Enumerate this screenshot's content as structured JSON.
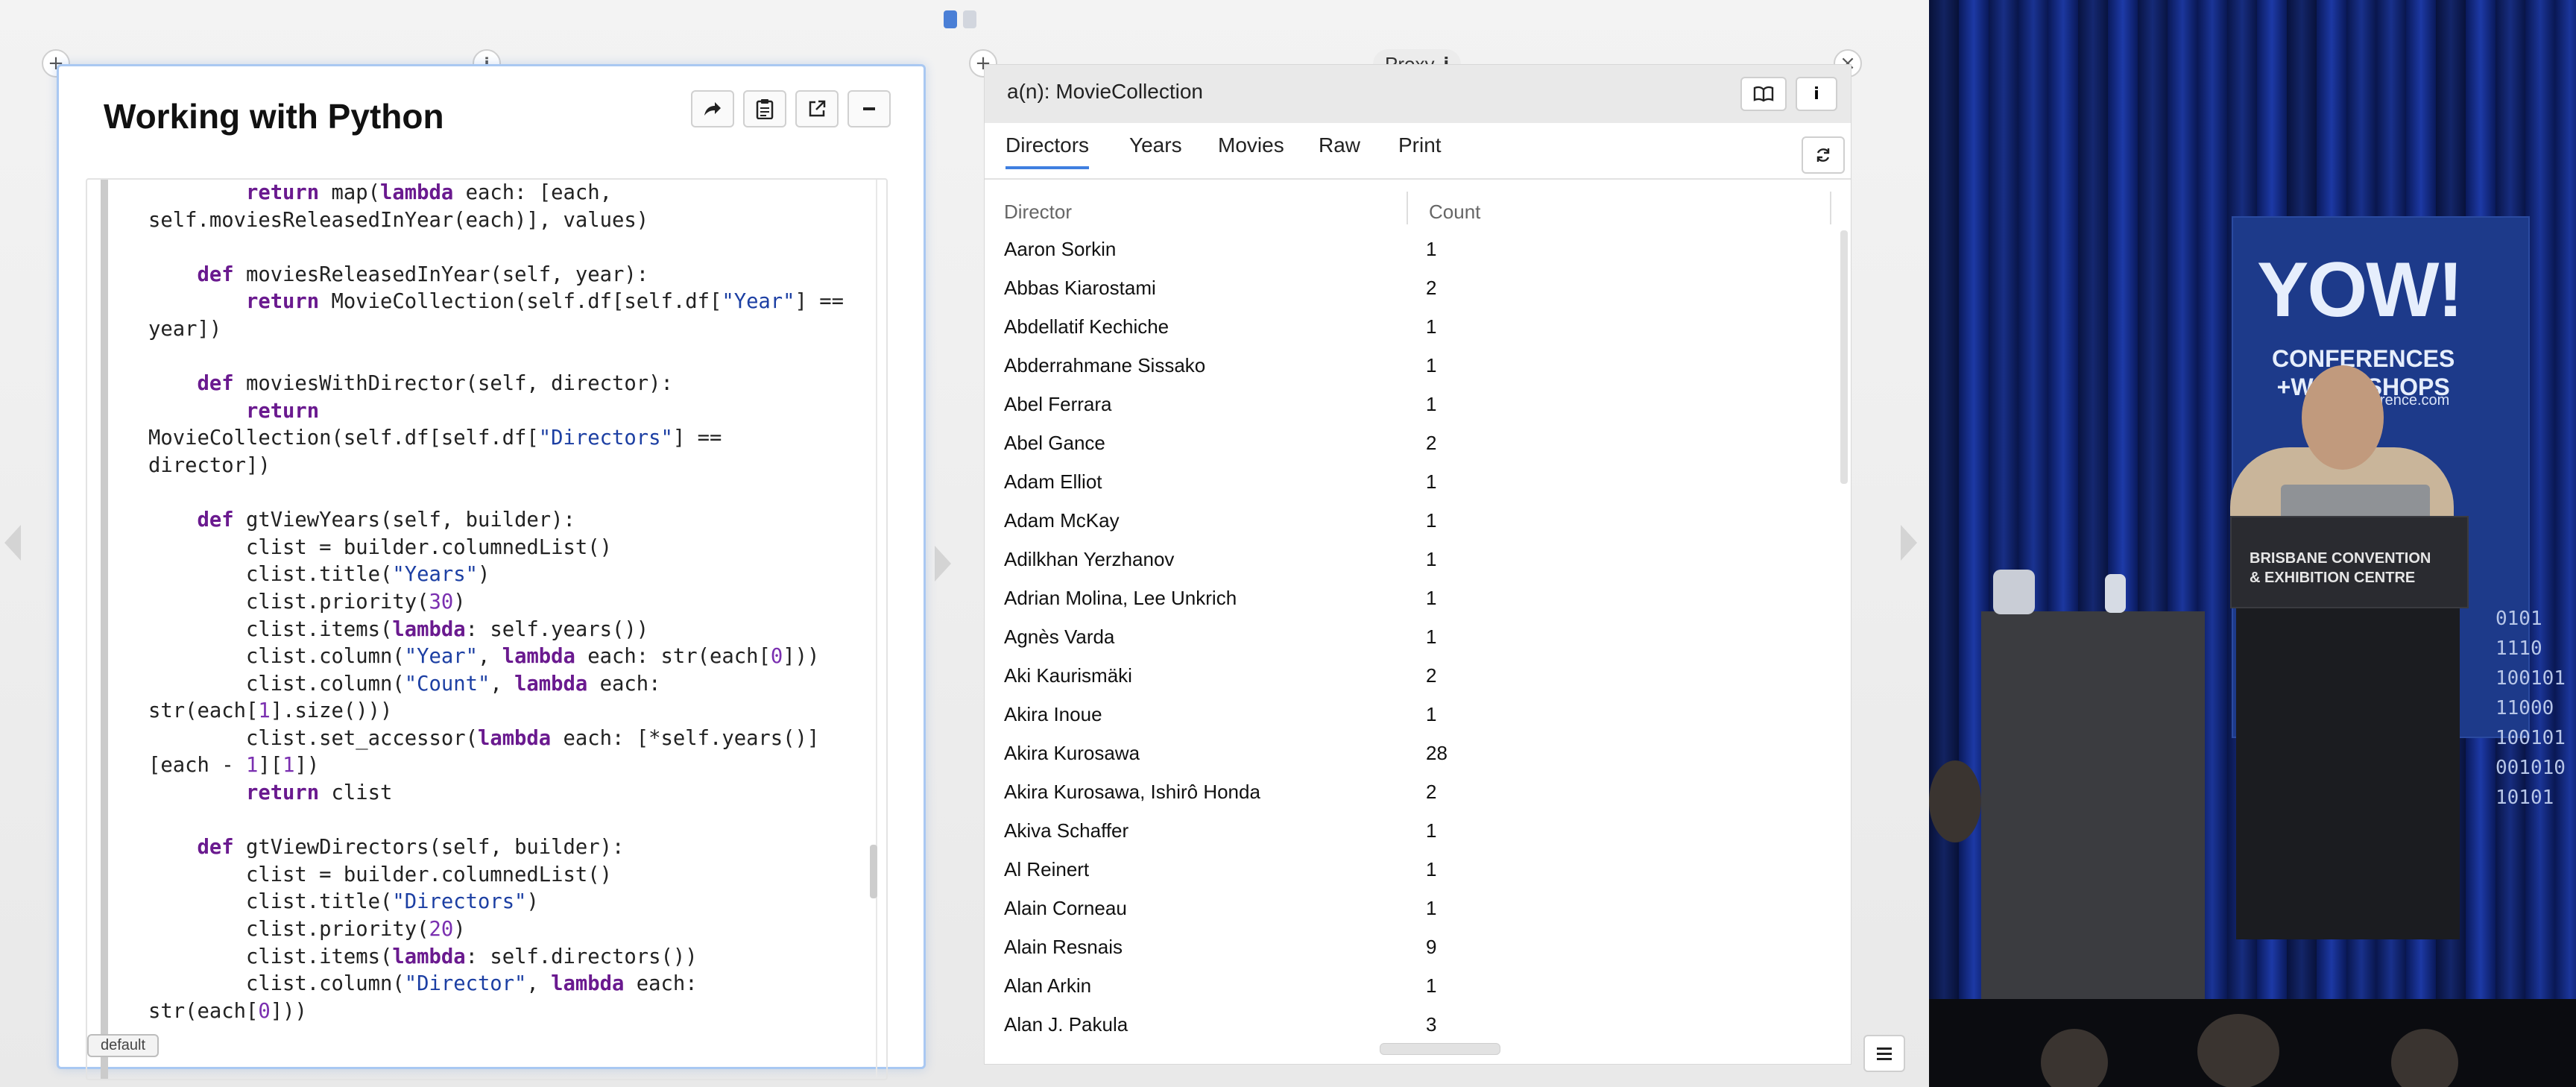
{
  "pager": {
    "count": 2,
    "active": 0
  },
  "code_pane": {
    "title": "Working with Python",
    "default_tag": "default",
    "code_lines": [
      [
        [
          "        ",
          ""
        ],
        [
          "return",
          "kw"
        ],
        [
          " map(",
          ""
        ],
        [
          "lambda",
          "kw"
        ],
        [
          " each: [each,",
          ""
        ]
      ],
      [
        [
          "self.moviesReleasedInYear(each)], values)",
          ""
        ]
      ],
      [
        [
          "",
          ""
        ]
      ],
      [
        [
          "    ",
          ""
        ],
        [
          "def",
          "kw"
        ],
        [
          " moviesReleasedInYear(self, year):",
          ""
        ]
      ],
      [
        [
          "        ",
          ""
        ],
        [
          "return",
          "kw"
        ],
        [
          " MovieCollection(self.df[self.df[",
          ""
        ],
        [
          "\"Year\"",
          "str"
        ],
        [
          "] ==",
          ""
        ]
      ],
      [
        [
          "year])",
          ""
        ]
      ],
      [
        [
          "",
          ""
        ]
      ],
      [
        [
          "    ",
          ""
        ],
        [
          "def",
          "kw"
        ],
        [
          " moviesWithDirector(self, director):",
          ""
        ]
      ],
      [
        [
          "        ",
          ""
        ],
        [
          "return",
          "kw"
        ]
      ],
      [
        [
          "MovieCollection(self.df[self.df[",
          ""
        ],
        [
          "\"Directors\"",
          "str"
        ],
        [
          "] ==",
          ""
        ]
      ],
      [
        [
          "director])",
          ""
        ]
      ],
      [
        [
          "",
          ""
        ]
      ],
      [
        [
          "    ",
          ""
        ],
        [
          "def",
          "kw"
        ],
        [
          " gtViewYears(self, builder):",
          ""
        ]
      ],
      [
        [
          "        clist = builder.columnedList()",
          ""
        ]
      ],
      [
        [
          "        clist.title(",
          ""
        ],
        [
          "\"Years\"",
          "str"
        ],
        [
          ")",
          ""
        ]
      ],
      [
        [
          "        clist.priority(",
          ""
        ],
        [
          "30",
          "num"
        ],
        [
          ")",
          ""
        ]
      ],
      [
        [
          "        clist.items(",
          ""
        ],
        [
          "lambda",
          "kw"
        ],
        [
          ": self.years())",
          ""
        ]
      ],
      [
        [
          "        clist.column(",
          ""
        ],
        [
          "\"Year\"",
          "str"
        ],
        [
          ", ",
          ""
        ],
        [
          "lambda",
          "kw"
        ],
        [
          " each: str(each[",
          ""
        ],
        [
          "0",
          "num"
        ],
        [
          "]))",
          ""
        ]
      ],
      [
        [
          "        clist.column(",
          ""
        ],
        [
          "\"Count\"",
          "str"
        ],
        [
          ", ",
          ""
        ],
        [
          "lambda",
          "kw"
        ],
        [
          " each:",
          ""
        ]
      ],
      [
        [
          "str(each[",
          ""
        ],
        [
          "1",
          "num"
        ],
        [
          "].size()))",
          ""
        ]
      ],
      [
        [
          "        clist.set_accessor(",
          ""
        ],
        [
          "lambda",
          "kw"
        ],
        [
          " each: [*self.years()]",
          ""
        ]
      ],
      [
        [
          "[each - ",
          ""
        ],
        [
          "1",
          "num"
        ],
        [
          "][",
          ""
        ],
        [
          "1",
          "num"
        ],
        [
          "])",
          ""
        ]
      ],
      [
        [
          "        ",
          ""
        ],
        [
          "return",
          "kw"
        ],
        [
          " clist",
          ""
        ]
      ],
      [
        [
          "",
          ""
        ]
      ],
      [
        [
          "    ",
          ""
        ],
        [
          "def",
          "kw"
        ],
        [
          " gtViewDirectors(self, builder):",
          ""
        ]
      ],
      [
        [
          "        clist = builder.columnedList()",
          ""
        ]
      ],
      [
        [
          "        clist.title(",
          ""
        ],
        [
          "\"Directors\"",
          "str"
        ],
        [
          ")",
          ""
        ]
      ],
      [
        [
          "        clist.priority(",
          ""
        ],
        [
          "20",
          "num"
        ],
        [
          ")",
          ""
        ]
      ],
      [
        [
          "        clist.items(",
          ""
        ],
        [
          "lambda",
          "kw"
        ],
        [
          ": self.directors())",
          ""
        ]
      ],
      [
        [
          "        clist.column(",
          ""
        ],
        [
          "\"Director\"",
          "str"
        ],
        [
          ", ",
          ""
        ],
        [
          "lambda",
          "kw"
        ],
        [
          " each:",
          ""
        ]
      ],
      [
        [
          "str(each[",
          ""
        ],
        [
          "0",
          "num"
        ],
        [
          "]))",
          ""
        ]
      ]
    ]
  },
  "inspector": {
    "title": "a(n): MovieCollection",
    "proxy_label": "Proxy",
    "tabs": [
      "Directors",
      "Years",
      "Movies",
      "Raw",
      "Print"
    ],
    "active_tab": 0,
    "columns": [
      "Director",
      "Count"
    ],
    "rows": [
      [
        "Aaron Sorkin",
        "1"
      ],
      [
        "Abbas Kiarostami",
        "2"
      ],
      [
        "Abdellatif Kechiche",
        "1"
      ],
      [
        "Abderrahmane Sissako",
        "1"
      ],
      [
        "Abel Ferrara",
        "1"
      ],
      [
        "Abel Gance",
        "2"
      ],
      [
        "Adam Elliot",
        "1"
      ],
      [
        "Adam McKay",
        "1"
      ],
      [
        "Adilkhan Yerzhanov",
        "1"
      ],
      [
        "Adrian Molina, Lee Unkrich",
        "1"
      ],
      [
        "Agnès Varda",
        "1"
      ],
      [
        "Aki Kaurismäki",
        "2"
      ],
      [
        "Akira Inoue",
        "1"
      ],
      [
        "Akira Kurosawa",
        "28"
      ],
      [
        "Akira Kurosawa, Ishirô Honda",
        "2"
      ],
      [
        "Akiva Schaffer",
        "1"
      ],
      [
        "Al Reinert",
        "1"
      ],
      [
        "Alain Corneau",
        "1"
      ],
      [
        "Alain Resnais",
        "9"
      ],
      [
        "Alan Arkin",
        "1"
      ],
      [
        "Alan J. Pakula",
        "3"
      ]
    ]
  },
  "video": {
    "banner_logo": "YOW!",
    "banner_sub_1": "CONFERENCES",
    "banner_sub_2": "+WORKSHOPS",
    "banner_url": "onference.com",
    "podium_line_1": "BRISBANE CONVENTION",
    "podium_line_2": "& EXHIBITION CENTRE",
    "binary_lines": [
      "0101 1110",
      "  100101",
      "   11000",
      "   100101",
      "   001010",
      "   10101"
    ]
  },
  "colors": {
    "accent": "#3f7fe0",
    "keyword": "#6a1a8f",
    "string": "#1c3fa3",
    "banner": "#1d3a8a"
  }
}
